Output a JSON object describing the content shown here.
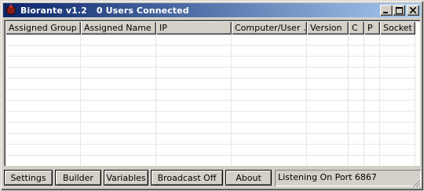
{
  "window": {
    "app_name": "Biorante v1.2",
    "connection_status": "0 Users Connected",
    "icon": "biorante-app-icon"
  },
  "title_controls": {
    "minimize_icon": "minimize-icon",
    "maximize_icon": "maximize-icon",
    "close_icon": "close-icon"
  },
  "table": {
    "columns": [
      {
        "key": "assigned_group",
        "label": "Assigned Group"
      },
      {
        "key": "assigned_name",
        "label": "Assigned Name"
      },
      {
        "key": "ip",
        "label": "IP"
      },
      {
        "key": "computer_user",
        "label": "Computer/User ..."
      },
      {
        "key": "version",
        "label": "Version"
      },
      {
        "key": "c",
        "label": "C"
      },
      {
        "key": "p",
        "label": "P"
      },
      {
        "key": "socket",
        "label": "Socket"
      }
    ],
    "rows": []
  },
  "buttons": {
    "settings": "Settings",
    "builder": "Builder",
    "variables": "Variables",
    "broadcast": "Broadcast Off",
    "about": "About"
  },
  "status_bar": {
    "text": "Listening On Port 6867"
  }
}
